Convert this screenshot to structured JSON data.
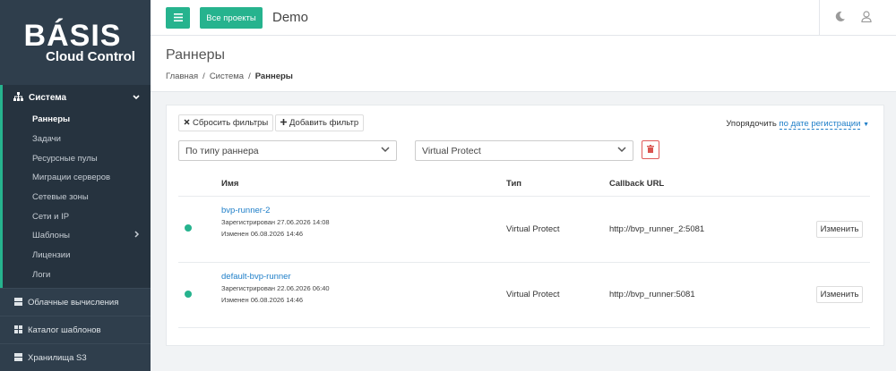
{
  "logo": {
    "brand": "BÁSIS",
    "sub": "Cloud Control"
  },
  "sidebar": {
    "section": {
      "label": "Система",
      "icon": "sitemap-icon",
      "items": [
        {
          "label": "Раннеры",
          "active": true
        },
        {
          "label": "Задачи"
        },
        {
          "label": "Ресурсные пулы"
        },
        {
          "label": "Миграции серверов"
        },
        {
          "label": "Сетевые зоны"
        },
        {
          "label": "Сети и IP"
        },
        {
          "label": "Шаблоны",
          "has_children": true
        },
        {
          "label": "Лицензии"
        },
        {
          "label": "Логи"
        }
      ]
    },
    "top_items": [
      {
        "label": "Облачные вычисления",
        "icon": "server-icon"
      },
      {
        "label": "Каталог шаблонов",
        "icon": "grid-icon"
      },
      {
        "label": "Хранилища S3",
        "icon": "storage-icon"
      }
    ]
  },
  "header": {
    "menu_icon": "≡",
    "projects_label": "Все проекты",
    "project": "Demo",
    "theme_icon": "moon-icon",
    "user_icon": "user-icon"
  },
  "page": {
    "title": "Раннеры",
    "breadcrumb": [
      "Главная",
      "Система",
      "Раннеры"
    ]
  },
  "filters": {
    "reset_label": "Сбросить фильтры",
    "add_label": "Добавить фильтр",
    "sort_prefix": "Упорядочить",
    "sort_value": "по дате регистрации",
    "select1": "По типу раннера",
    "select2": "Virtual Protect"
  },
  "table": {
    "columns": [
      "Имя",
      "Тип",
      "Callback URL"
    ],
    "edit_label": "Изменить",
    "rows": [
      {
        "name": "bvp-runner-2",
        "registered": "Зарегистрирован 27.06.2026 14:08",
        "changed": "Изменен 06.08.2026 14:46",
        "type": "Virtual Protect",
        "url": "http://bvp_runner_2:5081",
        "status_color": "#26b38e"
      },
      {
        "name": "default-bvp-runner",
        "registered": "Зарегистрирован 22.06.2026 06:40",
        "changed": "Изменен 06.08.2026 14:46",
        "type": "Virtual Protect",
        "url": "http://bvp_runner:5081",
        "status_color": "#26b38e"
      }
    ]
  },
  "colors": {
    "accent": "#26b38e",
    "sidebar": "#2f3e4c",
    "link": "#1e7ec8",
    "danger": "#d9534f"
  }
}
